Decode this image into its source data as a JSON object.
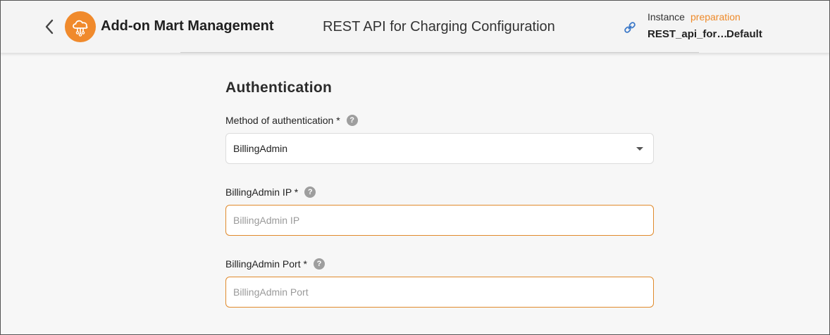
{
  "header": {
    "app_title": "Add-on Mart Management",
    "page_title": "REST API for Charging Configuration",
    "instance": {
      "label": "Instance",
      "status": "preparation",
      "name": "REST_api_for…",
      "environment": "Default"
    },
    "icons": {
      "back": "chevron-left-icon",
      "logo": "cloud-icon",
      "link": "link-icon"
    }
  },
  "form": {
    "section_title": "Authentication",
    "method": {
      "label": "Method of authentication *",
      "value": "BillingAdmin"
    },
    "ip": {
      "label": "BillingAdmin IP *",
      "placeholder": "BillingAdmin IP",
      "value": ""
    },
    "port": {
      "label": "BillingAdmin Port *",
      "placeholder": "BillingAdmin Port",
      "value": ""
    },
    "help_glyph": "?"
  },
  "colors": {
    "accent": "#f08a2c",
    "status": "#ee8a2a",
    "input_border": "#e08a2c",
    "background": "#f7f7f7"
  }
}
